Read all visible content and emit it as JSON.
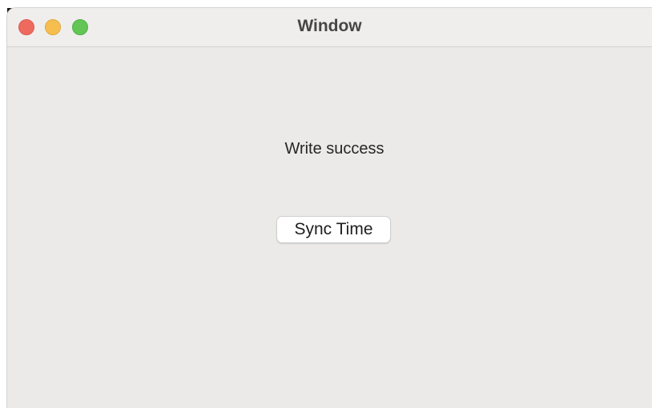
{
  "window": {
    "title": "Window"
  },
  "main": {
    "status_text": "Write success",
    "sync_button_label": "Sync Time"
  },
  "colors": {
    "close": "#ee6a5f",
    "minimize": "#f5be4f",
    "zoom": "#62c554",
    "window_background": "#ebeae9"
  },
  "icons": {
    "close": "close-traffic-light-icon",
    "minimize": "minimize-traffic-light-icon",
    "zoom": "zoom-traffic-light-icon"
  }
}
